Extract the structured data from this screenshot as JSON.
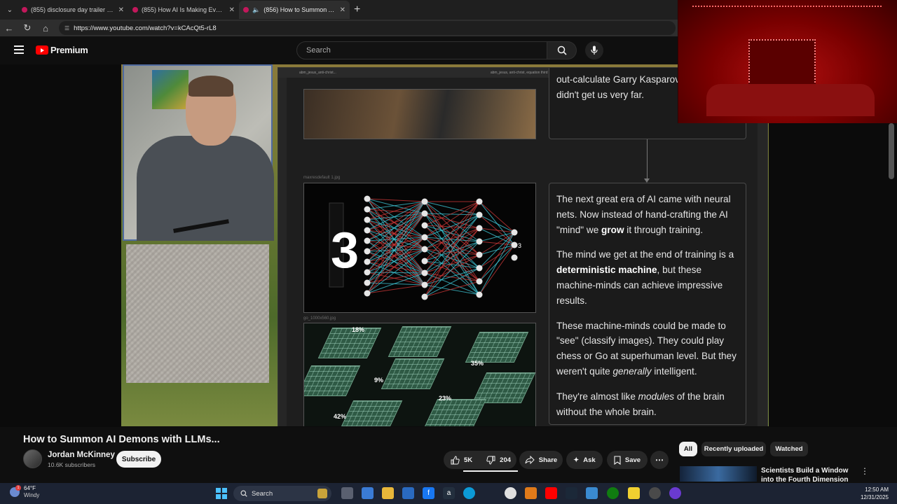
{
  "browser": {
    "tabs": [
      {
        "title": "(855) disclosure day trailer - YouTube",
        "active": false
      },
      {
        "title": "(855) How AI Is Making Everything",
        "active": false
      },
      {
        "title": "(856) How to Summon AI Demons",
        "active": true
      }
    ],
    "url": "https://www.youtube.com/watch?v=kCAcQt5-rL8"
  },
  "youtube": {
    "brand": "Premium",
    "search_placeholder": "Search"
  },
  "video_content": {
    "screen_tab_text": "abm_jesus_anti-christ...",
    "screen_path_text": "abm_jesus, anti-christ, equation third way, ai, demons",
    "top_box_text": "out-calculate Garry Kasparov ... approach didn't get us very far.",
    "label_nn": "maxresdefault 1.jpg",
    "label_go": "go_1000x560.jpg",
    "go_percents": [
      "18%",
      "9%",
      "35%",
      "23%",
      "42%"
    ],
    "nn_output": "3",
    "paragraphs": {
      "p1_a": "The next great era of AI came with neural nets. Now instead of hand-crafting the AI \"mind\" we ",
      "p1_b": "grow",
      "p1_c": " it through training.",
      "p2_a": "The mind we get at the end of training is a ",
      "p2_b": "deterministic machine",
      "p2_c": ", but these machine-minds can achieve impressive results.",
      "p3_a": "These machine-minds could be made to \"see\" (classify images). They could play chess or Go at superhuman level. But they weren't quite ",
      "p3_b": "generally",
      "p3_c": " intelligent.",
      "p4_a": "They're almost like ",
      "p4_b": "modules",
      "p4_c": " of the brain without the whole brain."
    }
  },
  "video_info": {
    "title": "How to Summon AI Demons with LLMs...",
    "channel": "Jordan McKinney",
    "subscribers": "10.6K subscribers",
    "subscribe_label": "Subscribe",
    "likes": "5K",
    "dislikes": "204",
    "share_label": "Share",
    "ask_label": "Ask",
    "save_label": "Save"
  },
  "chips": [
    "All",
    "Recently uploaded",
    "Watched"
  ],
  "recommendation": {
    "title": "Scientists Build a Window into the Fourth Dimension"
  },
  "taskbar": {
    "temp": "64°F",
    "condition": "Windy",
    "weather_badge": "1",
    "search_label": "Search",
    "time": "12:50 AM",
    "date": "12/31/2025"
  }
}
